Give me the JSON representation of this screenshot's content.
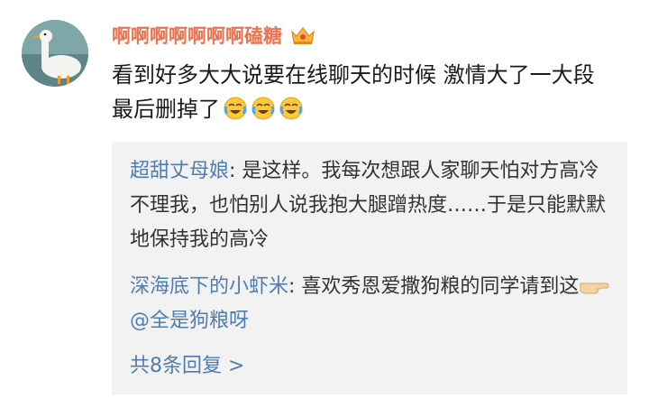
{
  "post": {
    "username": "啊啊啊啊啊啊啊磕糖",
    "badge_icon": "crown-icon",
    "text": "看到好多大大说要在线聊天的时候 激情大了一大段 最后删掉了",
    "trailing_emojis": [
      "laugh-cry-emoji",
      "laugh-cry-emoji",
      "laugh-cry-emoji"
    ]
  },
  "replies": [
    {
      "author": "超甜丈母娘",
      "separator": ": ",
      "text": "是这样。我每次想跟人家聊天怕对方高冷不理我，也怕别人说我抱大腿蹭热度……于是只能默默地保持我的高冷"
    },
    {
      "author": "深海底下的小虾米",
      "separator": ": ",
      "text": "喜欢秀恩爱撒狗粮的同学请到这",
      "emoji": "pointing-hand-emoji",
      "mention": "@全是狗粮呀"
    }
  ],
  "more_replies": "共8条回复 >",
  "colors": {
    "username": "#eb7350",
    "link": "#507daf",
    "reply_bg": "#f2f2f2"
  }
}
